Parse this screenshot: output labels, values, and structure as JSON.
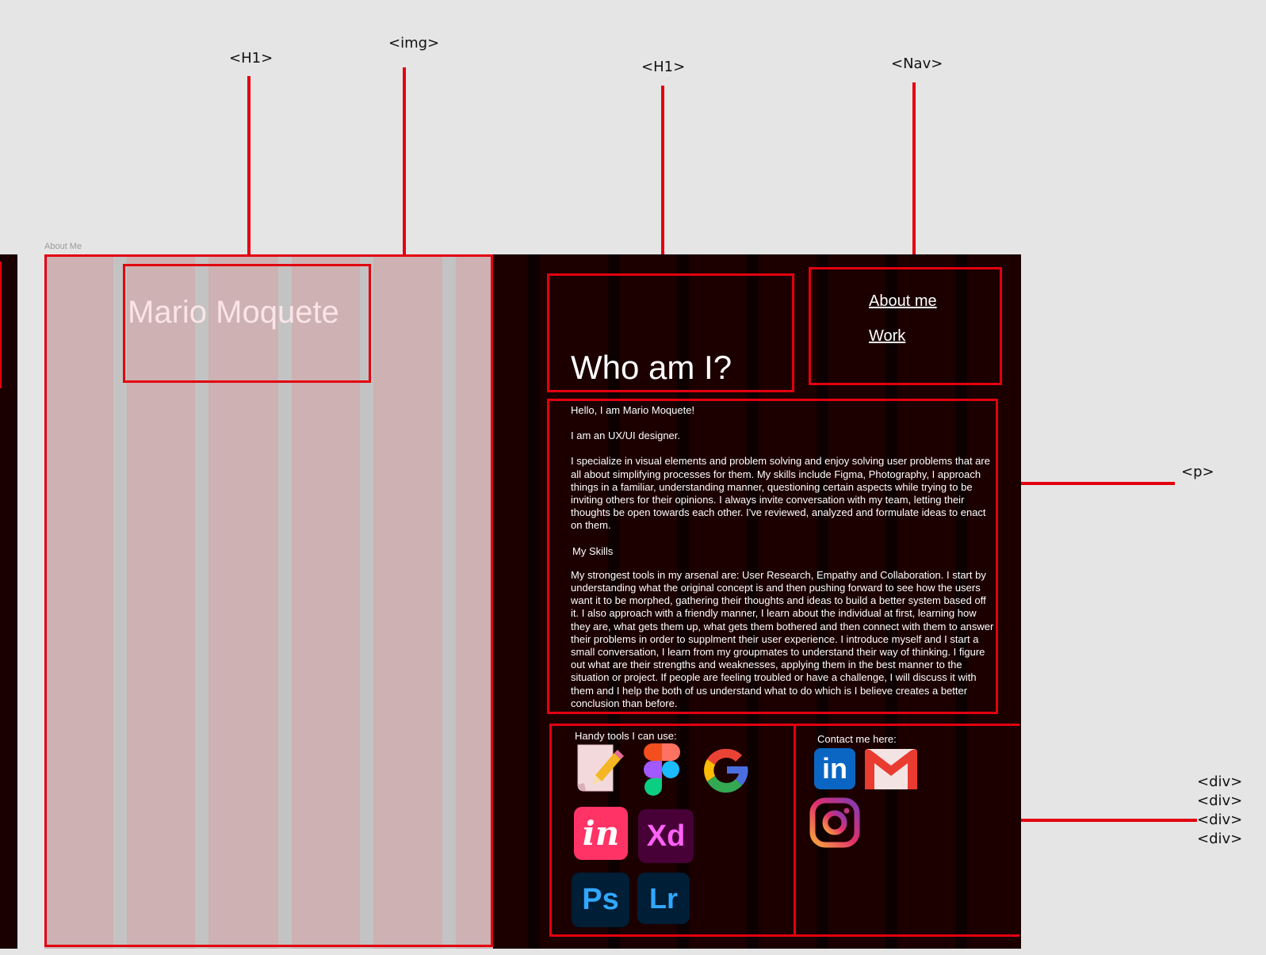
{
  "annotations": {
    "h1_left": "<H1>",
    "img": "<img>",
    "h1_right": "<H1>",
    "nav": "<Nav>",
    "p": "<p>",
    "divs": [
      "<div>",
      "<div>",
      "<div>",
      "<div>"
    ]
  },
  "frame": {
    "label": "About Me"
  },
  "page": {
    "name": "Mario Moquete",
    "heading": "Who am I?",
    "nav": [
      "About me",
      "Work"
    ],
    "bio": {
      "greeting": "Hello, I am Mario Moquete!",
      "role": "I am an UX/UI designer.",
      "intro": "I specialize in visual elements and problem solving and enjoy solving user problems that are all about simplifying processes for them. My skills include Figma, Photography, I approach things in a familiar, understanding manner, questioning certain aspects while trying to be inviting others for their opinions. I always invite conversation with my team, letting their thoughts be open towards each other. I've reviewed, analyzed and formulate ideas to enact on them.",
      "skills_heading": "My Skills",
      "skills": "My strongest tools in my arsenal are: User Research, Empathy and Collaboration. I start by understanding what the original concept is and then pushing forward to see how the users want it to be morphed, gathering their thoughts and ideas to build a better system based off it. I also approach with a friendly manner, I learn about the individual at first, learning how they are, what gets them up, what gets them bothered and then connect with them to answer their problems in order to supplment their user experience. I introduce myself and I start a small conversation, I learn from my groupmates to understand their way of thinking. I figure out what are their strengths and weaknesses, applying them in the best manner to the situation or project. If people are feeling troubled or have a challenge, I will discuss it with them and I help the both of us understand what to do which is I believe creates a better conclusion than before."
    },
    "tools": {
      "label": "Handy tools I can use:",
      "icons": [
        "notes-pencil-icon",
        "figma-icon",
        "google-icon",
        "invision-icon",
        "adobe-xd-icon",
        "photoshop-icon",
        "lightroom-icon"
      ],
      "icon_text": {
        "invision": "in",
        "xd": "Xd",
        "ps": "Ps",
        "lr": "Lr",
        "google": "G",
        "linkedin": "in"
      }
    },
    "contact": {
      "label": "Contact  me here:",
      "icons": [
        "linkedin-icon",
        "gmail-icon",
        "instagram-icon"
      ]
    }
  },
  "colors": {
    "frame_bg": "#1c0000",
    "image_placeholder": "#cdb1b3",
    "annotation_red": "#e3000f",
    "name_text": "#fbe4e6"
  }
}
